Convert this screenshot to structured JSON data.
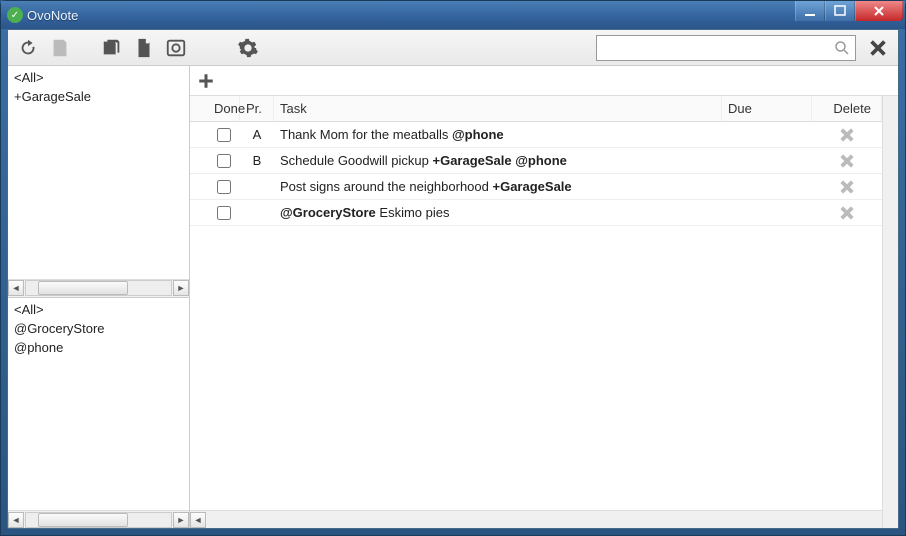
{
  "window": {
    "title": "OvoNote"
  },
  "search": {
    "value": "",
    "placeholder": ""
  },
  "sidebar": {
    "projects": [
      {
        "label": "<All>"
      },
      {
        "label": "+GarageSale"
      }
    ],
    "contexts": [
      {
        "label": "<All>"
      },
      {
        "label": "@GroceryStore"
      },
      {
        "label": "@phone"
      }
    ]
  },
  "columns": {
    "done": "Done",
    "priority": "Pr.",
    "task": "Task",
    "due": "Due",
    "delete": "Delete"
  },
  "tasks": [
    {
      "done": false,
      "priority": "A",
      "text": "Thank Mom for the meatballs ",
      "tags": "@phone",
      "tags2": "",
      "due": ""
    },
    {
      "done": false,
      "priority": "B",
      "text": "Schedule Goodwill pickup ",
      "tags": "+GarageSale @phone",
      "tags2": "",
      "due": ""
    },
    {
      "done": false,
      "priority": "",
      "text": "Post signs around the neighborhood ",
      "tags": "+GarageSale",
      "tags2": "",
      "due": ""
    },
    {
      "done": false,
      "priority": "",
      "text": "",
      "tags": "@GroceryStore",
      "tags2": " Eskimo pies",
      "due": ""
    }
  ],
  "newtask": {
    "value": ""
  }
}
